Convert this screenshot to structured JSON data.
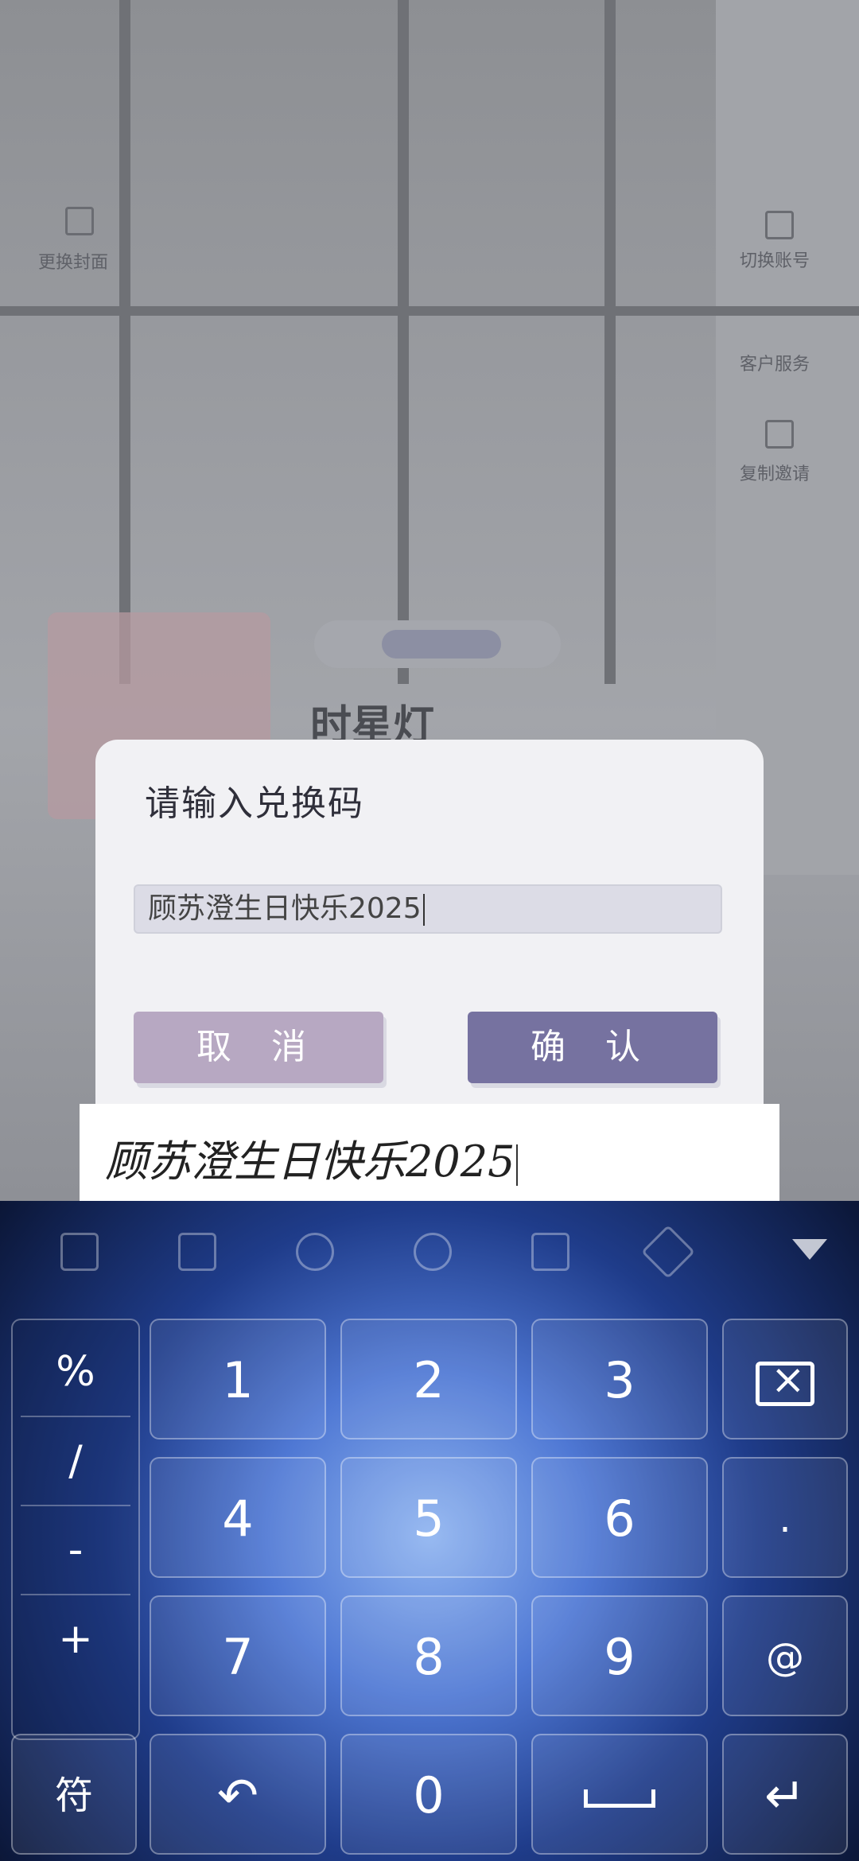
{
  "background_app": {
    "top_left_label": "更换封面",
    "right_labels": [
      "切换账号",
      "客户服务",
      "复制邀请"
    ],
    "title": "时星灯"
  },
  "dialog": {
    "title": "请输入兑换码",
    "code_value": "顾苏澄生日快乐2025",
    "cancel_label": "取 消",
    "confirm_label": "确 认"
  },
  "handwriting_preview": {
    "text": "顾苏澄生日快乐2025"
  },
  "keyboard": {
    "toolbar_icons": [
      "clipboard-icon",
      "keyboard-icon",
      "emoji-icon",
      "search-icon",
      "text-cursor-icon",
      "brush-icon",
      "collapse-icon"
    ],
    "symbols": [
      "%",
      "/",
      "-",
      "+"
    ],
    "keys": {
      "k1": "1",
      "k2": "2",
      "k3": "3",
      "k4": "4",
      "k5": "5",
      "k6": "6",
      "k7": "7",
      "k8": "8",
      "k9": "9",
      "k0": "0",
      "dot": ".",
      "at": "@",
      "symbols_key": "符",
      "undo": "↶",
      "enter": "↵"
    }
  },
  "colors": {
    "confirm": "#7672a0",
    "cancel": "#b7a8c2",
    "keyboard_accent": "#4f78d4"
  }
}
